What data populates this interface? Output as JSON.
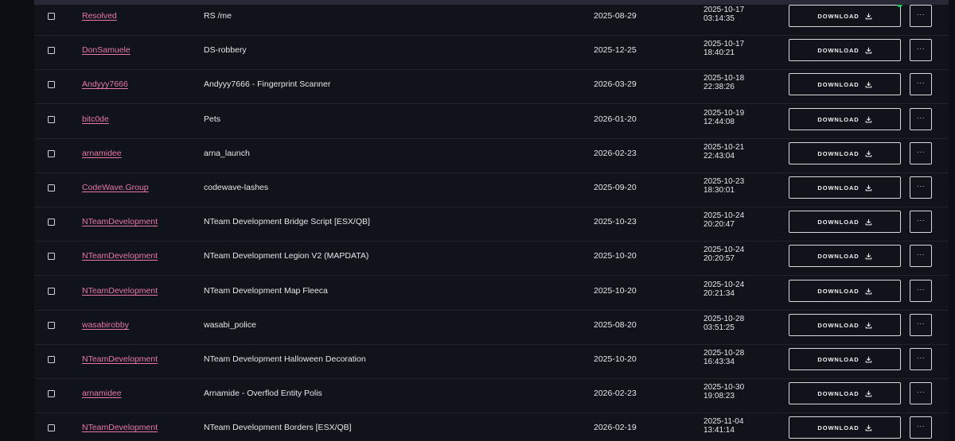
{
  "colors": {
    "background": "#0d0e14",
    "table_bg": "#11131b",
    "author_link": "#e879a6",
    "text": "#e6e6e6",
    "border": "#d9d9d9",
    "status_online": "#22c55e"
  },
  "icons": {
    "checkbox": "checkbox-icon",
    "download": "download-icon",
    "more": "more-icon"
  },
  "download_label": "DOWNLOAD",
  "more_label": "···",
  "rows": [
    {
      "author": "Resolved",
      "name": "RS /me",
      "expires": "2025-08-29",
      "updated_date": "2025-10-17",
      "updated_time": "03:14:35"
    },
    {
      "author": "DonSamuele",
      "name": "DS-robbery",
      "expires": "2025-12-25",
      "updated_date": "2025-10-17",
      "updated_time": "18:40:21"
    },
    {
      "author": "Andyyy7666",
      "name": "Andyyy7666 - Fingerprint Scanner",
      "expires": "2026-03-29",
      "updated_date": "2025-10-18",
      "updated_time": "22:38:26"
    },
    {
      "author": "bitc0de",
      "name": "Pets",
      "expires": "2026-01-20",
      "updated_date": "2025-10-19",
      "updated_time": "12:44:08"
    },
    {
      "author": "arnamidee",
      "name": "arna_launch",
      "expires": "2026-02-23",
      "updated_date": "2025-10-21",
      "updated_time": "22:43:04"
    },
    {
      "author": "CodeWave.Group",
      "name": "codewave-lashes",
      "expires": "2025-09-20",
      "updated_date": "2025-10-23",
      "updated_time": "18:30:01"
    },
    {
      "author": "NTeamDevelopment",
      "name": "NTeam Development Bridge Script [ESX/QB]",
      "expires": "2025-10-23",
      "updated_date": "2025-10-24",
      "updated_time": "20:20:47"
    },
    {
      "author": "NTeamDevelopment",
      "name": "NTeam Development Legion V2 (MAPDATA)",
      "expires": "2025-10-20",
      "updated_date": "2025-10-24",
      "updated_time": "20:20:57"
    },
    {
      "author": "NTeamDevelopment",
      "name": "NTeam Development Map Fleeca",
      "expires": "2025-10-20",
      "updated_date": "2025-10-24",
      "updated_time": "20:21:34"
    },
    {
      "author": "wasabirobby",
      "name": "wasabi_police",
      "expires": "2025-08-20",
      "updated_date": "2025-10-28",
      "updated_time": "03:51:25"
    },
    {
      "author": "NTeamDevelopment",
      "name": "NTeam Development Halloween Decoration",
      "expires": "2025-10-20",
      "updated_date": "2025-10-28",
      "updated_time": "16:43:34"
    },
    {
      "author": "arnamidee",
      "name": "Arnamide - Overflod Entity Polis",
      "expires": "2026-02-23",
      "updated_date": "2025-10-30",
      "updated_time": "19:08:23"
    },
    {
      "author": "NTeamDevelopment",
      "name": "NTeam Development Borders [ESX/QB]",
      "expires": "2026-02-19",
      "updated_date": "2025-11-04",
      "updated_time": "13:41:14"
    }
  ]
}
